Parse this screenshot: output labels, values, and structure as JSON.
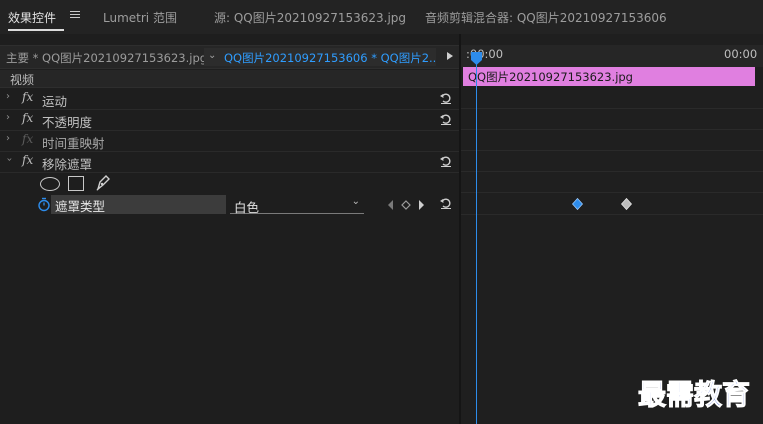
{
  "tabs": [
    {
      "label": "效果控件"
    },
    {
      "label": "Lumetri 范围"
    },
    {
      "label": "源: QQ图片20210927153623.jpg"
    },
    {
      "label": "音频剪辑混合器: QQ图片20210927153606"
    }
  ],
  "source_bar": {
    "master_label": "主要 * QQ图片20210927153623.jpg",
    "sequence_label": "QQ图片20210927153606 * QQ图片2..."
  },
  "timeline": {
    "tc_start": ":00:00",
    "tc_end": "00:00",
    "clip_name": "QQ图片20210927153623.jpg"
  },
  "panel": {
    "section_label": "视频",
    "effects": [
      {
        "label": "运动"
      },
      {
        "label": "不透明度"
      },
      {
        "label": "时间重映射"
      },
      {
        "label": "移除遮罩"
      }
    ],
    "mask_type": {
      "label": "遮罩类型",
      "value": "白色"
    }
  },
  "watermark": "最需教育",
  "colors": {
    "accent_blue": "#2d8ceb",
    "clip_pink": "#e07fe0",
    "watermark_blue": "#1f3fcf"
  },
  "icons": [
    "menu-icon",
    "twirl-icon",
    "fx-badge-icon",
    "reset-icon",
    "ellipse-mask-icon",
    "rectangle-mask-icon",
    "pen-mask-icon",
    "stopwatch-icon",
    "prev-keyframe-icon",
    "add-keyframe-icon",
    "next-keyframe-icon",
    "keyframe-diamond-icon",
    "playhead-icon"
  ]
}
